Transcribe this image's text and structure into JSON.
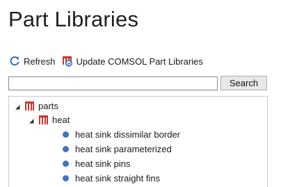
{
  "panel": {
    "title": "Part Libraries"
  },
  "toolbar": {
    "refresh_label": "Refresh",
    "refresh_icon": "refresh-icon",
    "update_label": "Update COMSOL Part Libraries",
    "update_icon": "library-update-icon"
  },
  "search": {
    "value": "",
    "placeholder": "",
    "button_label": "Search"
  },
  "tree": {
    "root": {
      "label": "parts",
      "expanded": true,
      "icon": "library-icon"
    },
    "folder": {
      "label": "heat",
      "expanded": true,
      "icon": "library-icon"
    },
    "items": [
      {
        "label": "heat sink dissimilar border",
        "icon": "part-dot-icon"
      },
      {
        "label": "heat sink parameterized",
        "icon": "part-dot-icon"
      },
      {
        "label": "heat sink pins",
        "icon": "part-dot-icon"
      },
      {
        "label": "heat sink straight fins",
        "icon": "part-dot-icon"
      }
    ]
  },
  "colors": {
    "accent_blue": "#3f73c5",
    "library_red": "#c0392b"
  }
}
